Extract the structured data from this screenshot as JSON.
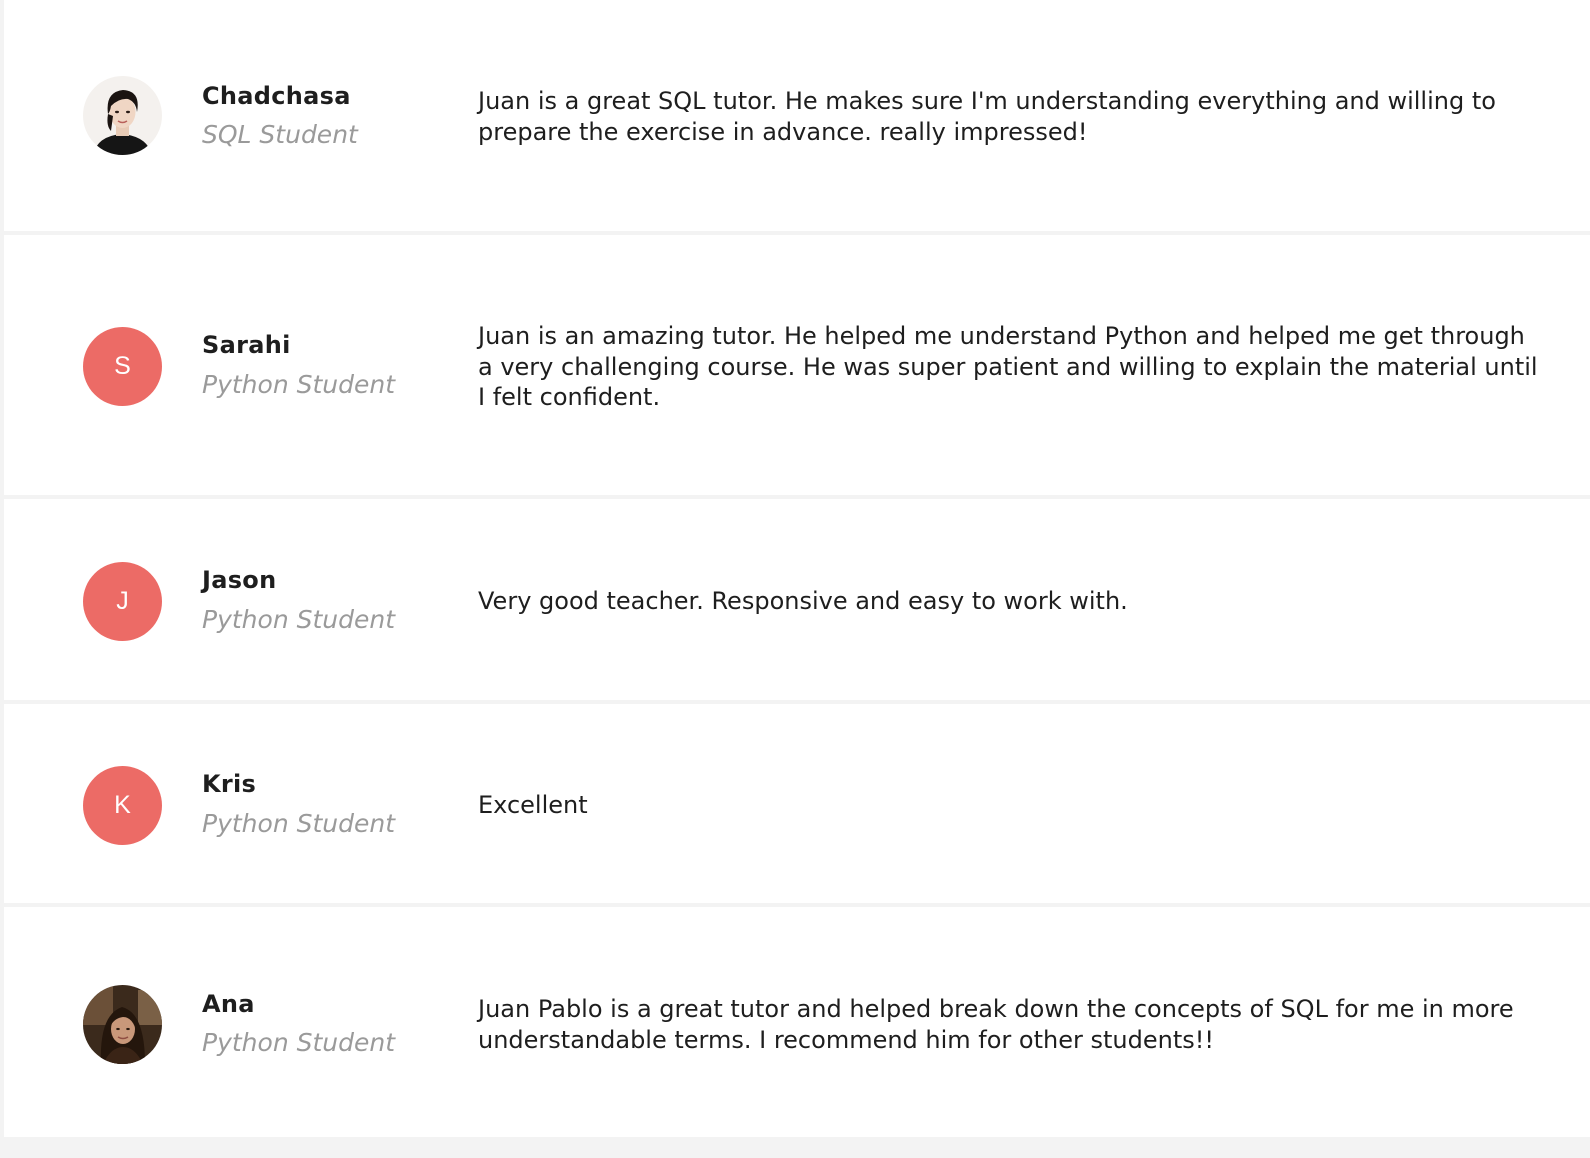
{
  "reviews": [
    {
      "name": "Chadchasa",
      "role": "SQL Student",
      "avatar_type": "photo",
      "text": "Juan is a great SQL tutor. He makes sure I'm understanding everything and willing to prepare the exercise in advance. really impressed!"
    },
    {
      "name": "Sarahi",
      "role": "Python Student",
      "avatar_type": "initial",
      "avatar_initial": "S",
      "text": "Juan is an amazing tutor. He helped me understand Python and helped me get through a very challenging course. He was super patient and willing to explain the material until I felt confident."
    },
    {
      "name": "Jason",
      "role": "Python Student",
      "avatar_type": "initial",
      "avatar_initial": "J",
      "text": "Very good teacher. Responsive and easy to work with."
    },
    {
      "name": "Kris",
      "role": "Python Student",
      "avatar_type": "initial",
      "avatar_initial": "K",
      "text": "Excellent"
    },
    {
      "name": "Ana",
      "role": "Python Student",
      "avatar_type": "photo",
      "text": "Juan Pablo is a great tutor and helped break down the concepts of SQL for me in more understandable terms. I recommend him for other students!!"
    }
  ],
  "colors": {
    "avatar_bg": "#ec6b66",
    "name": "#1e1e1e",
    "role": "#9a9a9a",
    "text": "#1e1e1e",
    "divider": "#f3f3f3"
  }
}
